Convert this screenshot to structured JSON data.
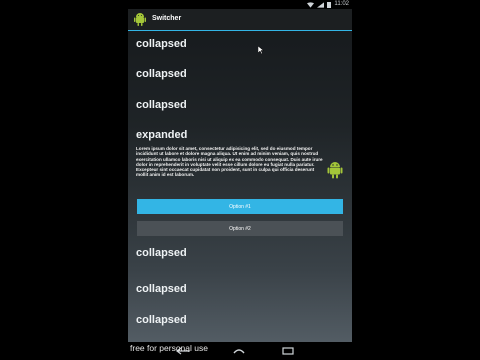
{
  "status_bar": {
    "time": "11:02"
  },
  "action_bar": {
    "title": "Switcher"
  },
  "list": [
    {
      "label": "collapsed"
    },
    {
      "label": "collapsed"
    },
    {
      "label": "collapsed"
    },
    {
      "label": "expanded"
    },
    {
      "label": "collapsed"
    },
    {
      "label": "collapsed"
    },
    {
      "label": "collapsed"
    }
  ],
  "expanded_content": {
    "text": "Lorem ipsum dolor sit amet, consectetur adipisicing elit, sed do eiusmod tempor incididunt ut labore et dolore magna aliqua. Ut enim ad minim veniam, quis nostrud exercitation ullamco laboris nisi ut aliquip ex ea commodo consequat. Duis aute irure dolor in reprehenderit in voluptate velit esse cillum dolore eu fugiat nulla pariatur. Excepteur sint occaecat cupidatat non proident, sunt in culpa qui officia deserunt mollit anim id est laborum.",
    "option1": "Option #1",
    "option2": "Option #2"
  },
  "watermark": "free for personal use",
  "colors": {
    "accent": "#33b5e5",
    "android_green": "#a4c639"
  }
}
